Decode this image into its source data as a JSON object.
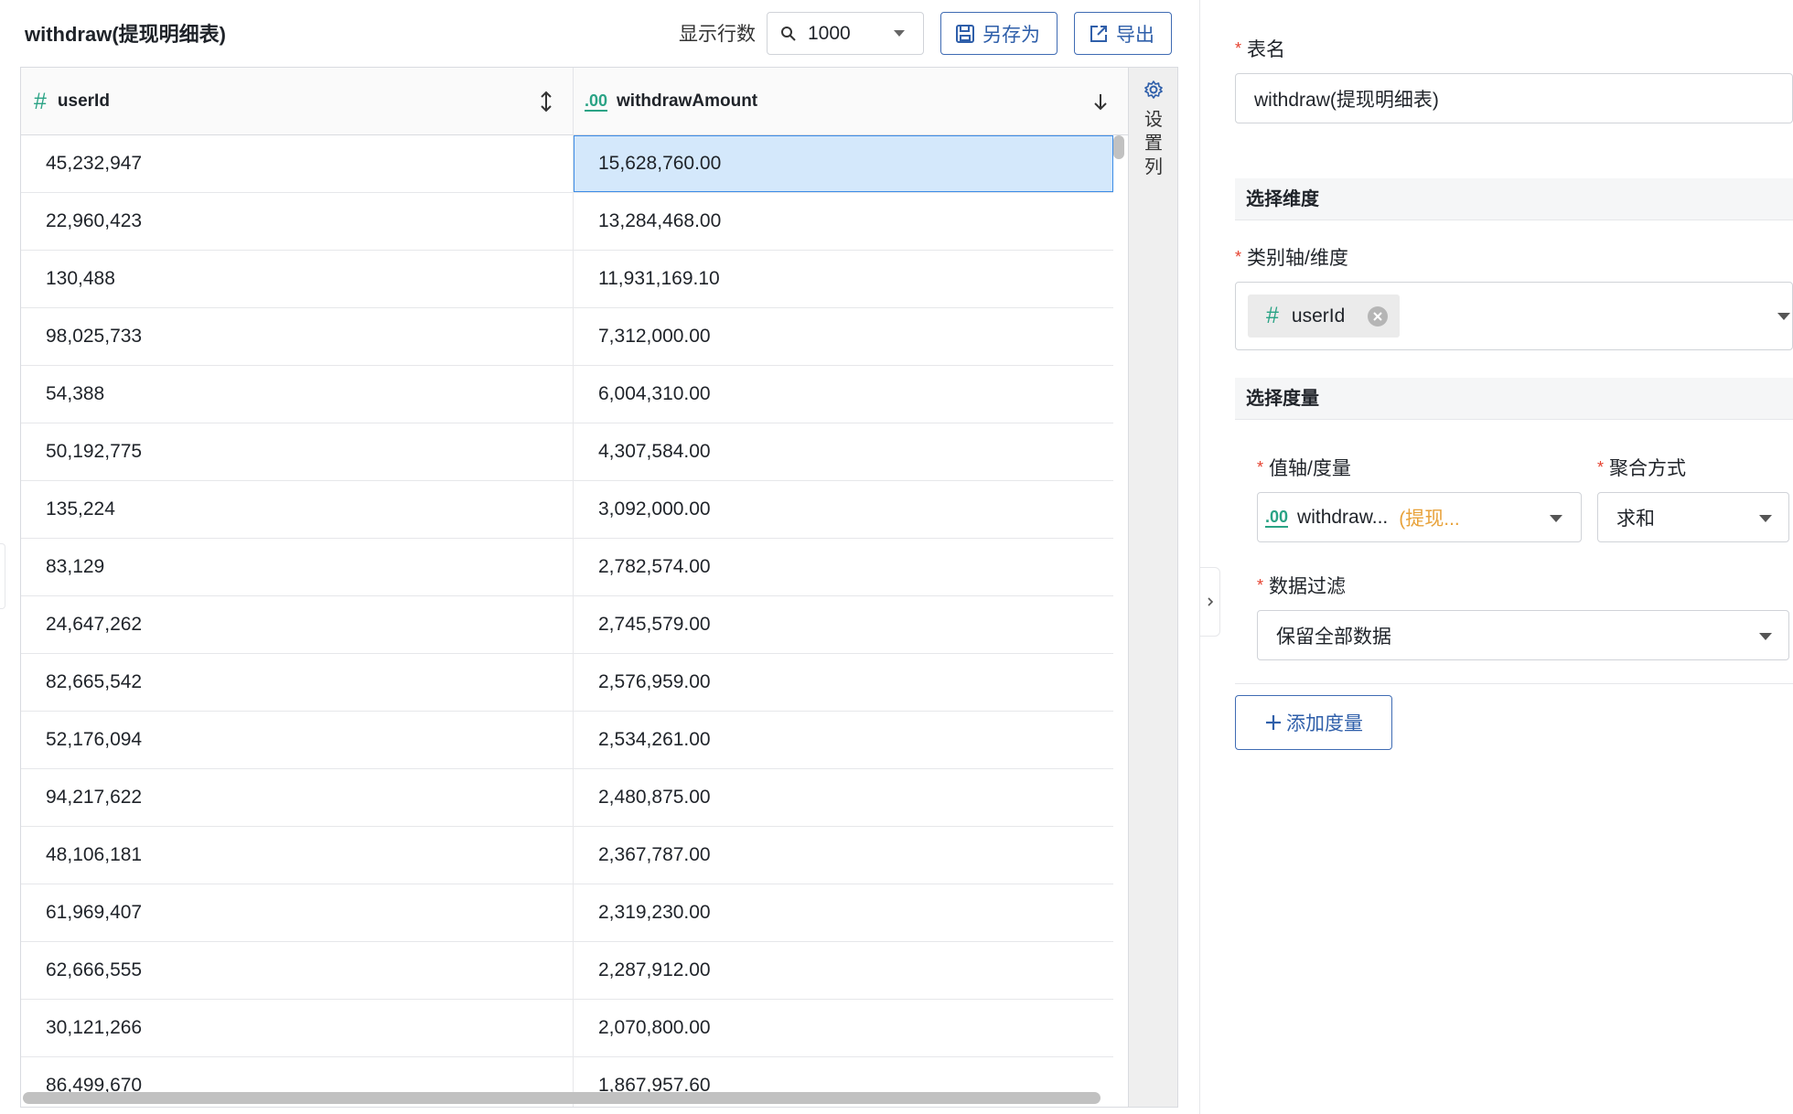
{
  "header": {
    "title": "withdraw(提现明细表)",
    "rows_label": "显示行数",
    "rows_value": "1000",
    "save_as_label": "另存为",
    "export_label": "导出"
  },
  "table": {
    "columns": [
      {
        "type_icon": "#",
        "name": "userId",
        "sort": "both"
      },
      {
        "type_icon": ".00",
        "name": "withdrawAmount",
        "sort": "desc"
      }
    ],
    "settings_label": [
      "设",
      "置",
      "列"
    ],
    "rows": [
      [
        "45,232,947",
        "15,628,760.00"
      ],
      [
        "22,960,423",
        "13,284,468.00"
      ],
      [
        "130,488",
        "11,931,169.10"
      ],
      [
        "98,025,733",
        "7,312,000.00"
      ],
      [
        "54,388",
        "6,004,310.00"
      ],
      [
        "50,192,775",
        "4,307,584.00"
      ],
      [
        "135,224",
        "3,092,000.00"
      ],
      [
        "83,129",
        "2,782,574.00"
      ],
      [
        "24,647,262",
        "2,745,579.00"
      ],
      [
        "82,665,542",
        "2,576,959.00"
      ],
      [
        "52,176,094",
        "2,534,261.00"
      ],
      [
        "94,217,622",
        "2,480,875.00"
      ],
      [
        "48,106,181",
        "2,367,787.00"
      ],
      [
        "61,969,407",
        "2,319,230.00"
      ],
      [
        "62,666,555",
        "2,287,912.00"
      ],
      [
        "30,121,266",
        "2,070,800.00"
      ],
      [
        "86,499,670",
        "1,867,957.60"
      ]
    ]
  },
  "panel": {
    "table_name_label": "表名",
    "table_name_value": "withdraw(提现明细表)",
    "dimension_section": "选择维度",
    "dimension_label": "类别轴/维度",
    "dimension_tag_icon": "#",
    "dimension_tag": "userId",
    "measure_section": "选择度量",
    "value_axis_label": "值轴/度量",
    "value_axis_icon": ".00",
    "value_axis_field": "withdraw...",
    "value_axis_hint": "(提现...",
    "agg_label": "聚合方式",
    "agg_value": "求和",
    "filter_label": "数据过滤",
    "filter_value": "保留全部数据",
    "add_measure_label": "添加度量"
  },
  "colors": {
    "accent": "#2f5faa",
    "type_icon": "#2aa385",
    "selected_cell": "#d4e8fb",
    "required": "#e5412f",
    "hint": "#e8a23a"
  }
}
